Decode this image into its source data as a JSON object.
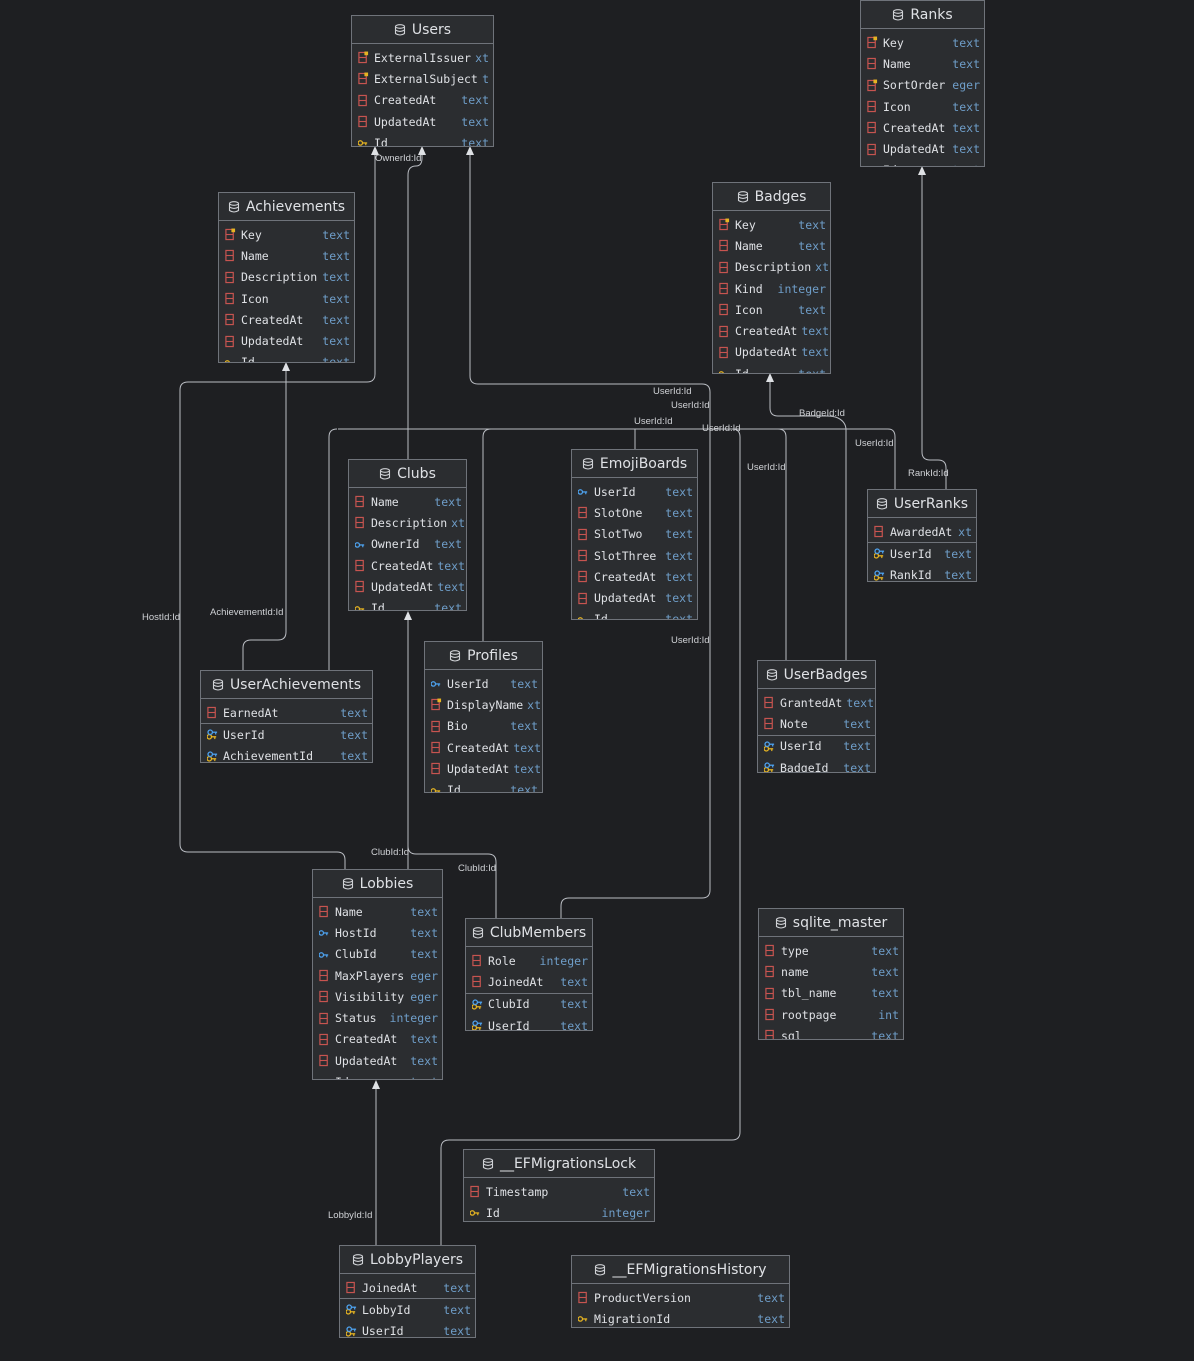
{
  "colors": {
    "background": "#1e1f22",
    "table_bg": "#2b2d30",
    "border": "#6f737a",
    "column_name": "#dfe1e5",
    "column_type": "#6f9ec9",
    "wire": "#b9bcc2",
    "column_icon": "#c75450",
    "key_icon": "#e6b422",
    "foreign_key_icon": "#4ea3f0"
  },
  "tables": [
    {
      "id": "users",
      "name": "Users",
      "icon": "table-icon",
      "columns": [
        {
          "name": "ExternalIssuer",
          "type": "xt",
          "icon": "index-column-icon"
        },
        {
          "name": "ExternalSubject",
          "type": "t",
          "icon": "index-column-icon"
        },
        {
          "name": "CreatedAt",
          "type": "text",
          "icon": "column-icon"
        },
        {
          "name": "UpdatedAt",
          "type": "text",
          "icon": "column-icon"
        },
        {
          "name": "Id",
          "type": "text",
          "icon": "primary-key-icon"
        }
      ]
    },
    {
      "id": "ranks",
      "name": "Ranks",
      "icon": "table-icon",
      "columns": [
        {
          "name": "Key",
          "type": "text",
          "icon": "index-column-icon"
        },
        {
          "name": "Name",
          "type": "text",
          "icon": "column-icon"
        },
        {
          "name": "SortOrder",
          "type": "eger",
          "icon": "index-column-icon"
        },
        {
          "name": "Icon",
          "type": "text",
          "icon": "column-icon"
        },
        {
          "name": "CreatedAt",
          "type": "text",
          "icon": "column-icon"
        },
        {
          "name": "UpdatedAt",
          "type": "text",
          "icon": "column-icon"
        },
        {
          "name": "Id",
          "type": "text",
          "icon": "primary-key-icon"
        }
      ]
    },
    {
      "id": "achievements",
      "name": "Achievements",
      "icon": "table-icon",
      "columns": [
        {
          "name": "Key",
          "type": "text",
          "icon": "index-column-icon"
        },
        {
          "name": "Name",
          "type": "text",
          "icon": "column-icon"
        },
        {
          "name": "Description",
          "type": "text",
          "icon": "column-icon"
        },
        {
          "name": "Icon",
          "type": "text",
          "icon": "column-icon"
        },
        {
          "name": "CreatedAt",
          "type": "text",
          "icon": "column-icon"
        },
        {
          "name": "UpdatedAt",
          "type": "text",
          "icon": "column-icon"
        },
        {
          "name": "Id",
          "type": "text",
          "icon": "primary-key-icon"
        }
      ]
    },
    {
      "id": "badges",
      "name": "Badges",
      "icon": "table-icon",
      "columns": [
        {
          "name": "Key",
          "type": "text",
          "icon": "index-column-icon"
        },
        {
          "name": "Name",
          "type": "text",
          "icon": "column-icon"
        },
        {
          "name": "Description",
          "type": "xt",
          "icon": "column-icon"
        },
        {
          "name": "Kind",
          "type": "integer",
          "icon": "column-icon"
        },
        {
          "name": "Icon",
          "type": "text",
          "icon": "column-icon"
        },
        {
          "name": "CreatedAt",
          "type": "text",
          "icon": "column-icon"
        },
        {
          "name": "UpdatedAt",
          "type": "text",
          "icon": "column-icon"
        },
        {
          "name": "Id",
          "type": "text",
          "icon": "primary-key-icon"
        }
      ]
    },
    {
      "id": "clubs",
      "name": "Clubs",
      "icon": "table-icon",
      "columns": [
        {
          "name": "Name",
          "type": "text",
          "icon": "column-icon"
        },
        {
          "name": "Description",
          "type": "xt",
          "icon": "column-icon"
        },
        {
          "name": "OwnerId",
          "type": "text",
          "icon": "foreign-key-icon"
        },
        {
          "name": "CreatedAt",
          "type": "text",
          "icon": "column-icon"
        },
        {
          "name": "UpdatedAt",
          "type": "text",
          "icon": "column-icon"
        },
        {
          "name": "Id",
          "type": "text",
          "icon": "primary-key-icon"
        }
      ]
    },
    {
      "id": "emojiboards",
      "name": "EmojiBoards",
      "icon": "table-icon",
      "columns": [
        {
          "name": "UserId",
          "type": "text",
          "icon": "foreign-key-icon"
        },
        {
          "name": "SlotOne",
          "type": "text",
          "icon": "column-icon"
        },
        {
          "name": "SlotTwo",
          "type": "text",
          "icon": "column-icon"
        },
        {
          "name": "SlotThree",
          "type": "text",
          "icon": "column-icon"
        },
        {
          "name": "CreatedAt",
          "type": "text",
          "icon": "column-icon"
        },
        {
          "name": "UpdatedAt",
          "type": "text",
          "icon": "column-icon"
        },
        {
          "name": "Id",
          "type": "text",
          "icon": "primary-key-icon"
        }
      ]
    },
    {
      "id": "userranks",
      "name": "UserRanks",
      "icon": "table-icon",
      "columns": [
        {
          "name": "AwardedAt",
          "type": "xt",
          "icon": "column-icon"
        },
        {
          "name": "UserId",
          "type": "text",
          "icon": "pk-foreign-key-icon",
          "sep": true
        },
        {
          "name": "RankId",
          "type": "text",
          "icon": "pk-foreign-key-icon"
        }
      ]
    },
    {
      "id": "profiles",
      "name": "Profiles",
      "icon": "table-icon",
      "columns": [
        {
          "name": "UserId",
          "type": "text",
          "icon": "foreign-key-icon"
        },
        {
          "name": "DisplayName",
          "type": "xt",
          "icon": "index-column-icon"
        },
        {
          "name": "Bio",
          "type": "text",
          "icon": "column-icon"
        },
        {
          "name": "CreatedAt",
          "type": "text",
          "icon": "column-icon"
        },
        {
          "name": "UpdatedAt",
          "type": "text",
          "icon": "column-icon"
        },
        {
          "name": "Id",
          "type": "text",
          "icon": "primary-key-icon"
        }
      ]
    },
    {
      "id": "userachievements",
      "name": "UserAchievements",
      "icon": "table-icon",
      "columns": [
        {
          "name": "EarnedAt",
          "type": "text",
          "icon": "column-icon"
        },
        {
          "name": "UserId",
          "type": "text",
          "icon": "pk-foreign-key-icon",
          "sep": true
        },
        {
          "name": "AchievementId",
          "type": "text",
          "icon": "pk-foreign-key-icon"
        }
      ]
    },
    {
      "id": "userbadges",
      "name": "UserBadges",
      "icon": "table-icon",
      "columns": [
        {
          "name": "GrantedAt",
          "type": "text",
          "icon": "column-icon"
        },
        {
          "name": "Note",
          "type": "text",
          "icon": "column-icon"
        },
        {
          "name": "UserId",
          "type": "text",
          "icon": "pk-foreign-key-icon",
          "sep": true
        },
        {
          "name": "BadgeId",
          "type": "text",
          "icon": "pk-foreign-key-icon"
        }
      ]
    },
    {
      "id": "lobbies",
      "name": "Lobbies",
      "icon": "table-icon",
      "columns": [
        {
          "name": "Name",
          "type": "text",
          "icon": "column-icon"
        },
        {
          "name": "HostId",
          "type": "text",
          "icon": "foreign-key-icon"
        },
        {
          "name": "ClubId",
          "type": "text",
          "icon": "foreign-key-icon"
        },
        {
          "name": "MaxPlayers",
          "type": "eger",
          "icon": "column-icon"
        },
        {
          "name": "Visibility",
          "type": "eger",
          "icon": "column-icon"
        },
        {
          "name": "Status",
          "type": "integer",
          "icon": "column-icon"
        },
        {
          "name": "CreatedAt",
          "type": "text",
          "icon": "column-icon"
        },
        {
          "name": "UpdatedAt",
          "type": "text",
          "icon": "column-icon"
        },
        {
          "name": "Id",
          "type": "text",
          "icon": "primary-key-icon"
        }
      ]
    },
    {
      "id": "clubmembers",
      "name": "ClubMembers",
      "icon": "table-icon",
      "columns": [
        {
          "name": "Role",
          "type": "integer",
          "icon": "column-icon"
        },
        {
          "name": "JoinedAt",
          "type": "text",
          "icon": "column-icon"
        },
        {
          "name": "ClubId",
          "type": "text",
          "icon": "pk-foreign-key-icon",
          "sep": true
        },
        {
          "name": "UserId",
          "type": "text",
          "icon": "pk-foreign-key-icon"
        }
      ]
    },
    {
      "id": "sqlite_master",
      "name": "sqlite_master",
      "icon": "table-icon",
      "columns": [
        {
          "name": "type",
          "type": "text",
          "icon": "column-icon"
        },
        {
          "name": "name",
          "type": "text",
          "icon": "column-icon"
        },
        {
          "name": "tbl_name",
          "type": "text",
          "icon": "column-icon"
        },
        {
          "name": "rootpage",
          "type": "int",
          "icon": "column-icon"
        },
        {
          "name": "sql",
          "type": "text",
          "icon": "column-icon"
        }
      ]
    },
    {
      "id": "efmigrationslock",
      "name": "__EFMigrationsLock",
      "icon": "table-icon",
      "columns": [
        {
          "name": "Timestamp",
          "type": "text",
          "icon": "column-icon"
        },
        {
          "name": "Id",
          "type": "integer",
          "icon": "primary-key-icon"
        }
      ]
    },
    {
      "id": "lobbyplayers",
      "name": "LobbyPlayers",
      "icon": "table-icon",
      "columns": [
        {
          "name": "JoinedAt",
          "type": "text",
          "icon": "column-icon"
        },
        {
          "name": "LobbyId",
          "type": "text",
          "icon": "pk-foreign-key-icon",
          "sep": true
        },
        {
          "name": "UserId",
          "type": "text",
          "icon": "pk-foreign-key-icon"
        }
      ]
    },
    {
      "id": "efmigrationshistory",
      "name": "__EFMigrationsHistory",
      "icon": "table-icon",
      "columns": [
        {
          "name": "ProductVersion",
          "type": "text",
          "icon": "column-icon"
        },
        {
          "name": "MigrationId",
          "type": "text",
          "icon": "primary-key-icon"
        }
      ]
    }
  ],
  "relation_labels": [
    {
      "id": "r-ownerid",
      "text": "OwnerId:Id"
    },
    {
      "id": "r-userid-a",
      "text": "UserId:Id"
    },
    {
      "id": "r-userid-b",
      "text": "UserId:Id"
    },
    {
      "id": "r-userid-c",
      "text": "UserId:Id"
    },
    {
      "id": "r-userid-d",
      "text": "UserId:Id"
    },
    {
      "id": "r-badgeid",
      "text": "BadgeId:Id"
    },
    {
      "id": "r-userid-e",
      "text": "UserId:Id"
    },
    {
      "id": "r-userid-f",
      "text": "UserId:Id"
    },
    {
      "id": "r-rankid",
      "text": "RankId:Id"
    },
    {
      "id": "r-hostid",
      "text": "HostId:Id"
    },
    {
      "id": "r-achievementid",
      "text": "AchievementId:Id"
    },
    {
      "id": "r-userid-g",
      "text": "UserId:Id"
    },
    {
      "id": "r-clubid-a",
      "text": "ClubId:Id"
    },
    {
      "id": "r-clubid-b",
      "text": "ClubId:Id"
    },
    {
      "id": "r-lobbyid",
      "text": "LobbyId:Id"
    }
  ]
}
